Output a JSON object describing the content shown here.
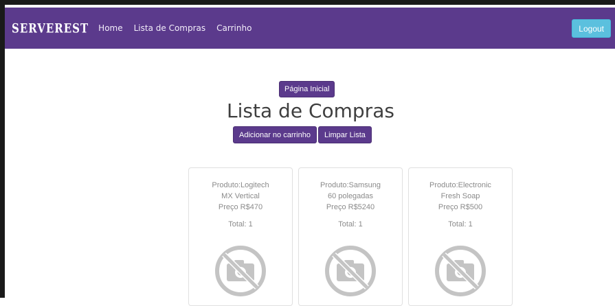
{
  "navbar": {
    "brand": "SERVEREST",
    "links": [
      "Home",
      "Lista de Compras",
      "Carrinho"
    ],
    "logout_label": "Logout",
    "colors": {
      "navbar": "#5b3a8c",
      "logout": "#5bc0de"
    }
  },
  "main": {
    "home_button": "Página Inicial",
    "title": "Lista de Compras",
    "add_to_cart_button": "Adicionar no carrinho",
    "clear_list_button": "Limpar Lista"
  },
  "products": [
    {
      "line1": "Produto:Logitech",
      "line2": "MX Vertical",
      "price": "Preço R$470",
      "total": "Total: 1",
      "image_icon": "no-camera-icon"
    },
    {
      "line1": "Produto:Samsung",
      "line2": "60 polegadas",
      "price": "Preço R$5240",
      "total": "Total: 1",
      "image_icon": "no-camera-icon"
    },
    {
      "line1": "Produto:Electronic",
      "line2": "Fresh Soap",
      "price": "Preço R$500",
      "total": "Total: 1",
      "image_icon": "no-camera-icon"
    }
  ]
}
